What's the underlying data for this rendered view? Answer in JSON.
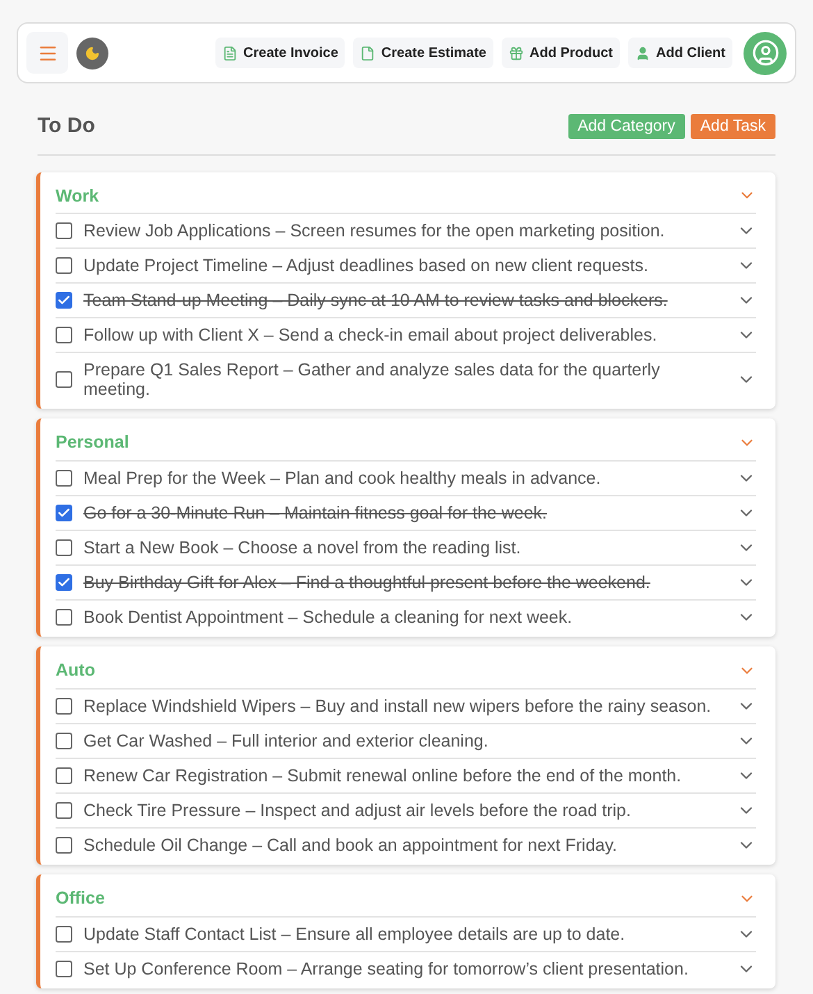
{
  "toolbar": {
    "actions": [
      {
        "label": "Create Invoice",
        "kind": "invoice"
      },
      {
        "label": "Create Estimate",
        "kind": "estimate"
      },
      {
        "label": "Add Product",
        "kind": "product"
      },
      {
        "label": "Add Client",
        "kind": "client"
      }
    ]
  },
  "page": {
    "title": "To Do",
    "buttons": [
      {
        "label": "Add Category",
        "kind": "green"
      },
      {
        "label": "Add Task",
        "kind": "orange"
      }
    ]
  },
  "categories": [
    {
      "name": "Work",
      "expanded": true,
      "tasks": [
        {
          "text": "Review Job Applications – Screen resumes for the open marketing position.",
          "checked": false
        },
        {
          "text": "Update Project Timeline – Adjust deadlines based on new client requests.",
          "checked": false
        },
        {
          "text": "Team Stand-up Meeting – Daily sync at 10 AM to review tasks and blockers.",
          "checked": true
        },
        {
          "text": "Follow up with Client X – Send a check-in email about project deliverables.",
          "checked": false
        },
        {
          "text": "Prepare Q1 Sales Report – Gather and analyze sales data for the quarterly meeting.",
          "checked": false
        }
      ]
    },
    {
      "name": "Personal",
      "expanded": true,
      "tasks": [
        {
          "text": "Meal Prep for the Week – Plan and cook healthy meals in advance.",
          "checked": false
        },
        {
          "text": "Go for a 30-Minute Run – Maintain fitness goal for the week.",
          "checked": true
        },
        {
          "text": "Start a New Book – Choose a novel from the reading list.",
          "checked": false
        },
        {
          "text": "Buy Birthday Gift for Alex – Find a thoughtful present before the weekend.",
          "checked": true
        },
        {
          "text": "Book Dentist Appointment – Schedule a cleaning for next week.",
          "checked": false
        }
      ]
    },
    {
      "name": "Auto",
      "expanded": true,
      "tasks": [
        {
          "text": "Replace Windshield Wipers – Buy and install new wipers before the rainy season.",
          "checked": false
        },
        {
          "text": "Get Car Washed – Full interior and exterior cleaning.",
          "checked": false
        },
        {
          "text": "Renew Car Registration – Submit renewal online before the end of the month.",
          "checked": false
        },
        {
          "text": "Check Tire Pressure – Inspect and adjust air levels before the road trip.",
          "checked": false
        },
        {
          "text": "Schedule Oil Change – Call and book an appointment for next Friday.",
          "checked": false
        }
      ]
    },
    {
      "name": "Office",
      "expanded": true,
      "tasks": [
        {
          "text": "Update Staff Contact List – Ensure all employee details are up to date.",
          "checked": false
        },
        {
          "text": "Set Up Conference Room – Arrange seating for tomorrow’s client presentation.",
          "checked": false
        }
      ]
    }
  ]
}
